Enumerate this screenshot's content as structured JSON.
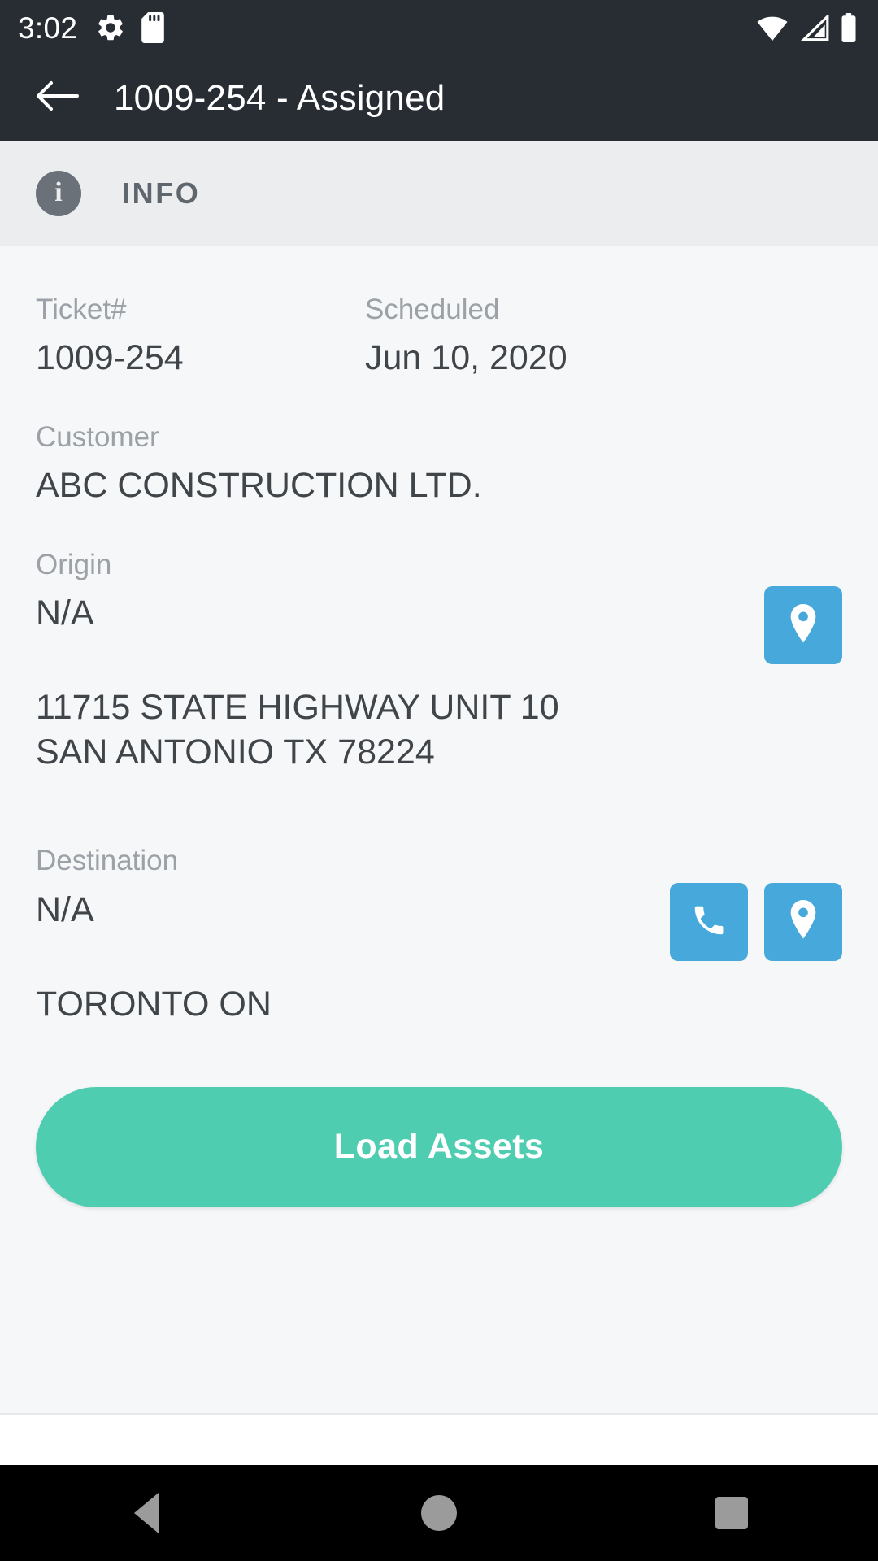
{
  "status_bar": {
    "time": "3:02",
    "left_icons": [
      "gear-icon",
      "sd-card-icon"
    ],
    "right_icons": [
      "wifi-icon",
      "cellular-signal-icon",
      "battery-icon"
    ]
  },
  "app_bar": {
    "back_icon": "arrow-left-icon",
    "title": "1009-254 - Assigned"
  },
  "tabs": {
    "info": {
      "icon": "info-circle-icon",
      "icon_glyph": "i",
      "label": "INFO"
    }
  },
  "details": {
    "ticket": {
      "label": "Ticket#",
      "value": "1009-254"
    },
    "scheduled": {
      "label": "Scheduled",
      "value": "Jun 10, 2020"
    },
    "customer": {
      "label": "Customer",
      "value": "ABC CONSTRUCTION LTD."
    },
    "origin": {
      "label": "Origin",
      "value": "N/A",
      "address": "11715 STATE HIGHWAY UNIT 10 SAN ANTONIO TX 78224",
      "map_icon": "map-pin-icon"
    },
    "destination": {
      "label": "Destination",
      "value": "N/A",
      "address": "TORONTO ON",
      "phone_icon": "phone-icon",
      "map_icon": "map-pin-icon"
    }
  },
  "actions": {
    "primary_label": "Load Assets"
  },
  "nav_bar": {
    "back_icon": "nav-back-triangle-icon",
    "home_icon": "nav-home-circle-icon",
    "recents_icon": "nav-recents-square-icon"
  },
  "colors": {
    "app_bar": "#272d33",
    "tab_strip": "#ecedef",
    "content_bg": "#f6f7f9",
    "label": "#9ba1a6",
    "value": "#404549",
    "action_blue": "#47a8db",
    "primary_teal": "#4ecdb0"
  }
}
